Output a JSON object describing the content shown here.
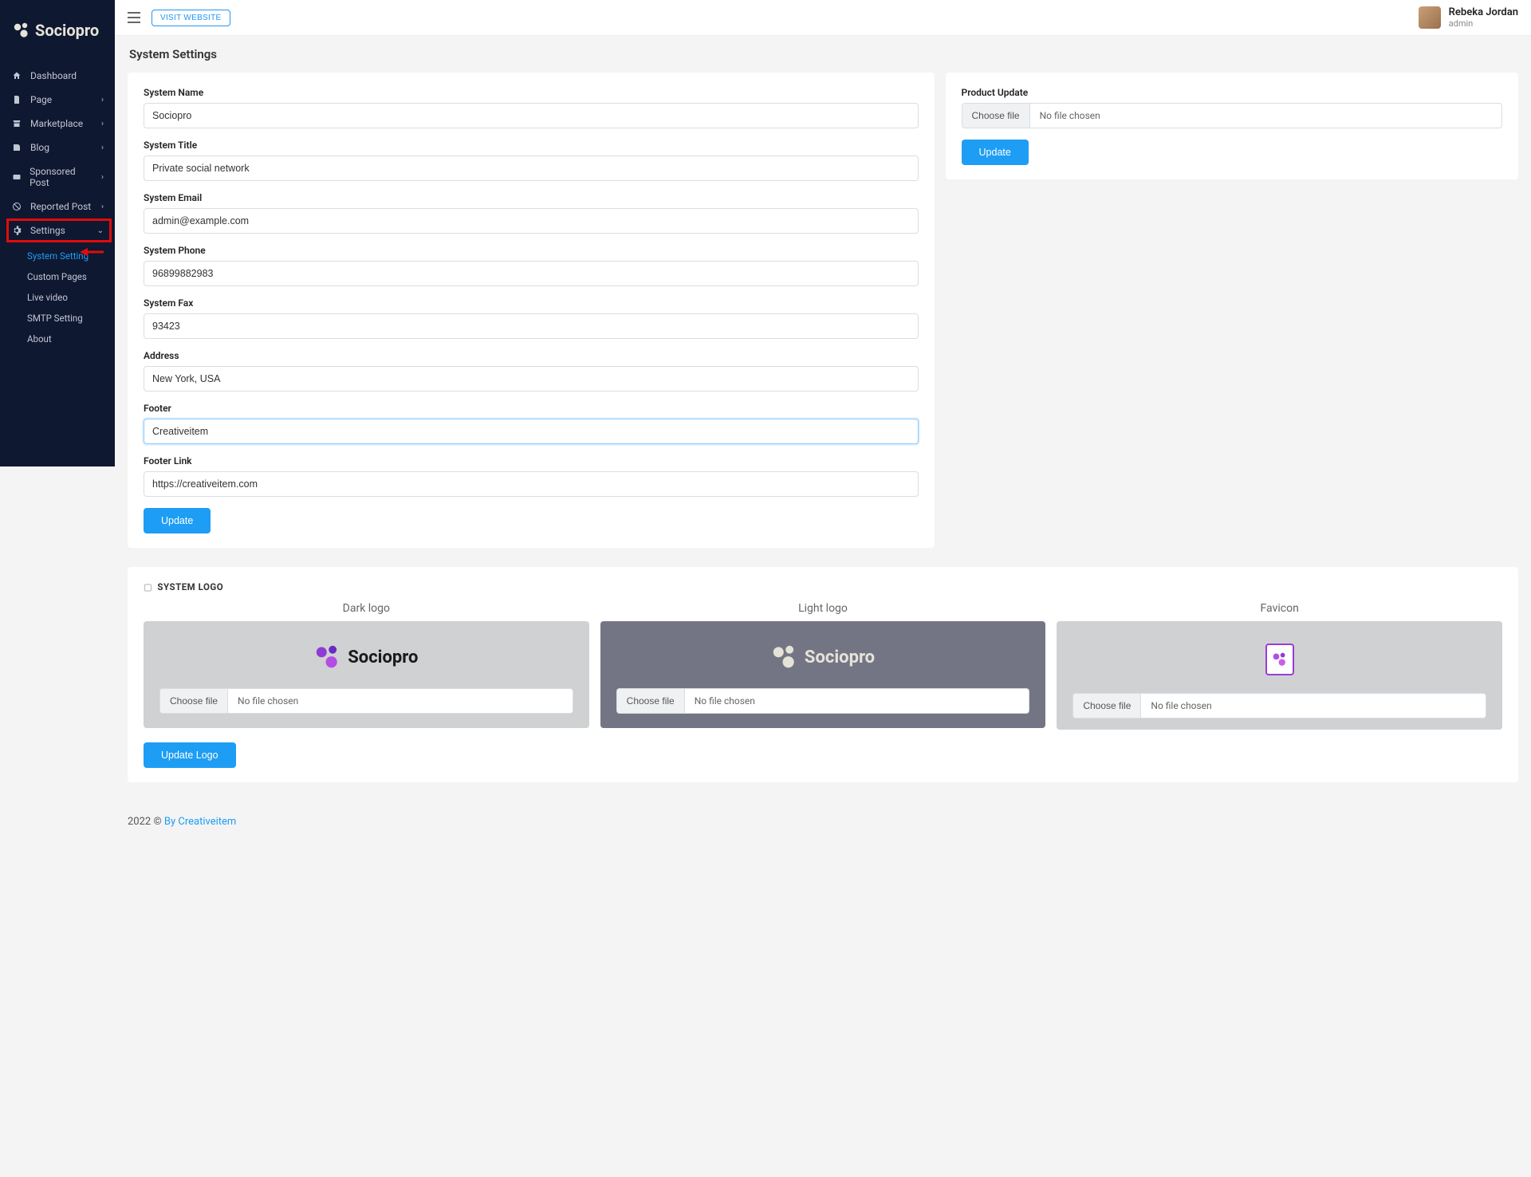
{
  "brand": {
    "name": "Sociopro"
  },
  "topbar": {
    "visit_label": "VISIT WEBSITE",
    "user": {
      "name": "Rebeka Jordan",
      "role": "admin"
    }
  },
  "nav": [
    {
      "icon": "home",
      "label": "Dashboard",
      "expandable": false
    },
    {
      "icon": "file",
      "label": "Page",
      "expandable": true
    },
    {
      "icon": "store",
      "label": "Marketplace",
      "expandable": true
    },
    {
      "icon": "blog",
      "label": "Blog",
      "expandable": true
    },
    {
      "icon": "ad",
      "label": "Sponsored Post",
      "expandable": true
    },
    {
      "icon": "ban",
      "label": "Reported Post",
      "expandable": true
    },
    {
      "icon": "gear",
      "label": "Settings",
      "expandable": true,
      "open": true,
      "highlighted": true,
      "children": [
        {
          "label": "System Setting",
          "active": true
        },
        {
          "label": "Custom Pages"
        },
        {
          "label": "Live video"
        },
        {
          "label": "SMTP Setting"
        },
        {
          "label": "About"
        }
      ]
    }
  ],
  "page": {
    "title": "System Settings"
  },
  "form": {
    "fields": {
      "system_name": {
        "label": "System Name",
        "value": "Sociopro"
      },
      "system_title": {
        "label": "System Title",
        "value": "Private social network"
      },
      "system_email": {
        "label": "System Email",
        "value": "admin@example.com"
      },
      "system_phone": {
        "label": "System Phone",
        "value": "96899882983"
      },
      "system_fax": {
        "label": "System Fax",
        "value": "93423"
      },
      "address": {
        "label": "Address",
        "value": "New York, USA"
      },
      "footer": {
        "label": "Footer",
        "value": "Creativeitem"
      },
      "footer_link": {
        "label": "Footer Link",
        "value": "https://creativeitem.com"
      }
    },
    "update_label": "Update"
  },
  "product_update": {
    "title": "Product Update",
    "choose_label": "Choose file",
    "no_file": "No file chosen",
    "update_label": "Update"
  },
  "system_logo": {
    "section_title": "SYSTEM LOGO",
    "columns": {
      "dark": {
        "title": "Dark logo",
        "brand": "Sociopro"
      },
      "light": {
        "title": "Light logo",
        "brand": "Sociopro"
      },
      "favicon": {
        "title": "Favicon"
      }
    },
    "choose_label": "Choose file",
    "no_file": "No file chosen",
    "update_label": "Update Logo"
  },
  "footer": {
    "year": "2022 ©",
    "by": "By Creativeitem"
  }
}
